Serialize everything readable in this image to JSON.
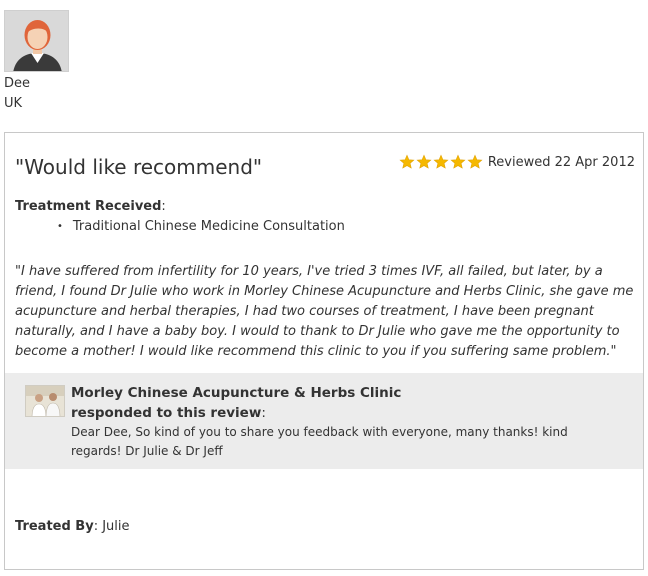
{
  "reviewer": {
    "name": "Dee",
    "location": "UK",
    "avatar_icon": "female-user-avatar-icon"
  },
  "review": {
    "title": "\"Would like recommend\"",
    "rating": 5,
    "rating_max": 5,
    "star_color": "#f5b800",
    "date_text": "Reviewed 22 Apr 2012",
    "treatment_label": "Treatment Received",
    "treatment_colon": ":",
    "treatments": [
      "Traditional Chinese Medicine Consultation"
    ],
    "body": "\"I have suffered from infertility for 10 years, I've tried 3 times IVF, all failed, but later, by a friend, I found Dr Julie who work in Morley Chinese Acupuncture and Herbs Clinic, she gave me acupuncture and herbal therapies, I had two courses of treatment, I have been pregnant naturally, and I have a baby boy. I would to thank to Dr Julie who gave me the opportunity to become a mother! I would like recommend this clinic to you if you suffering same problem.\"",
    "treated_by_label": "Treated By",
    "treated_by_colon": ":",
    "treated_by_value": " Julie"
  },
  "response": {
    "clinic_name": "Morley Chinese Acupuncture & Herbs Clinic",
    "responded_label": "responded to this review",
    "responded_colon": ":",
    "text": "Dear Dee, So kind of you to share you feedback with everyone, many thanks! kind regards! Dr Julie & Dr Jeff",
    "background": "#ececec"
  }
}
